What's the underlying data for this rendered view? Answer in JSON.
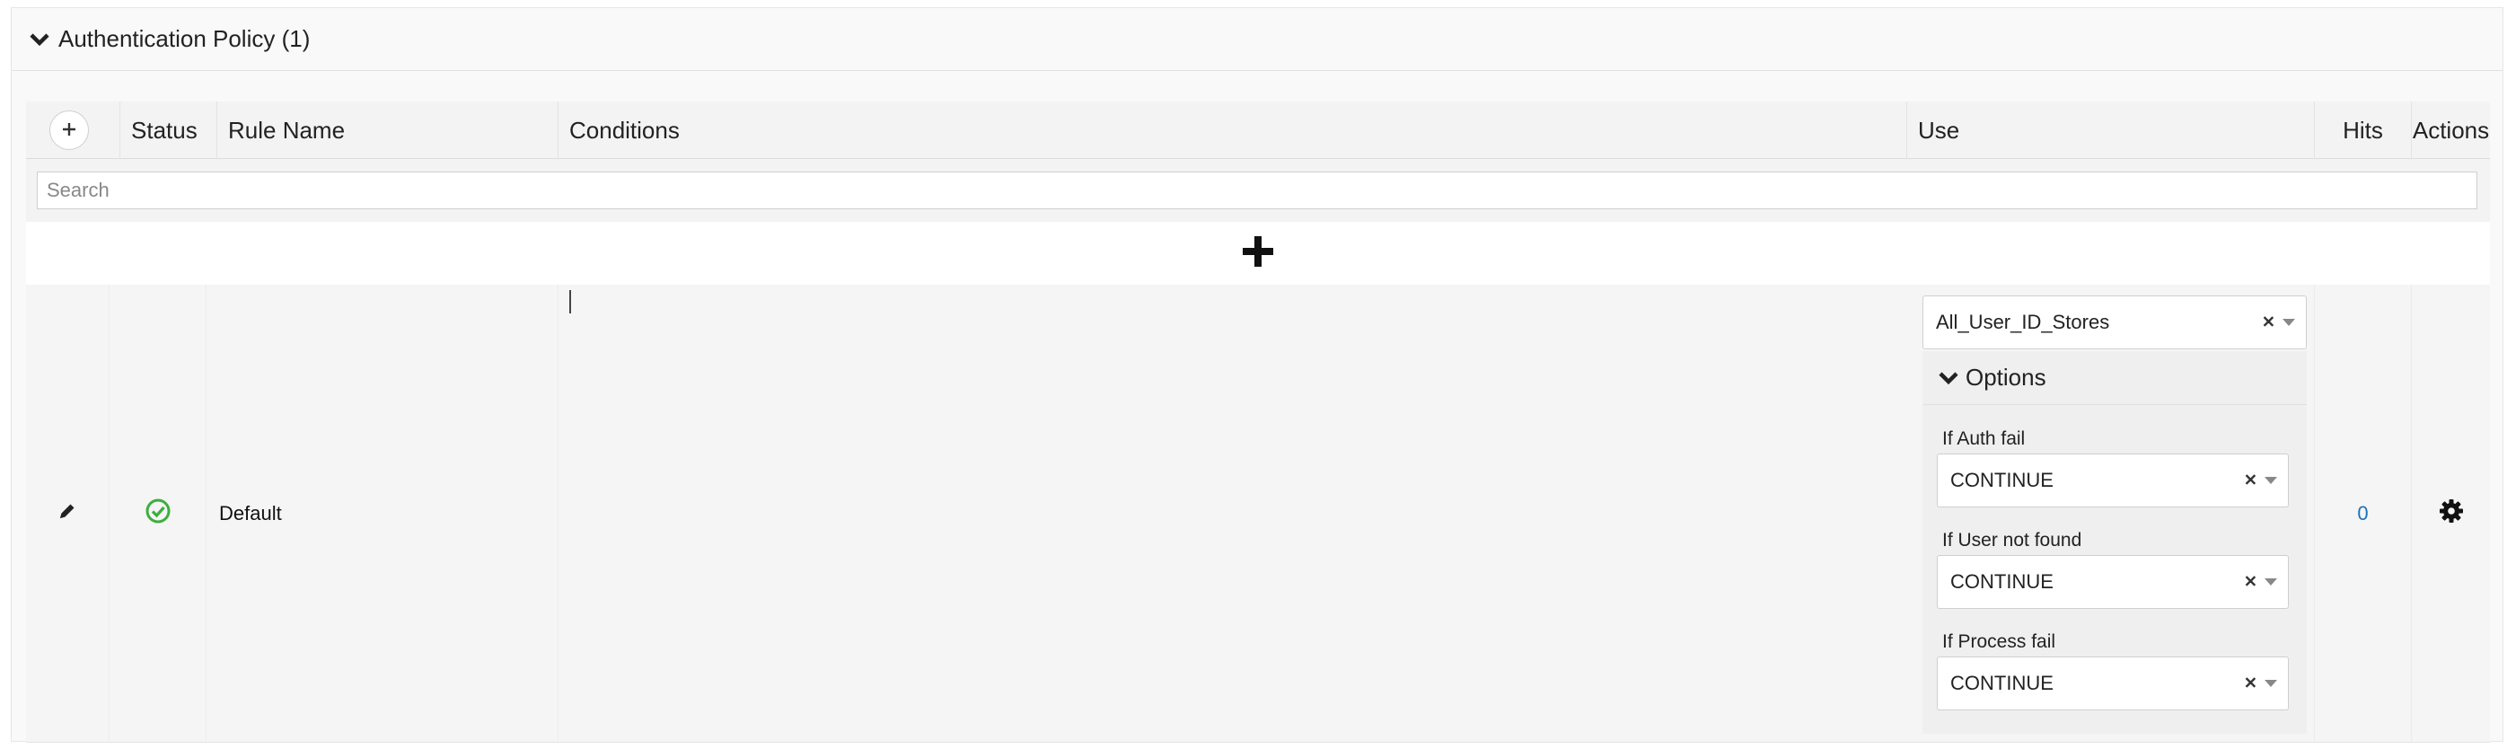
{
  "section": {
    "title": "Authentication Policy (1)"
  },
  "table": {
    "columns": {
      "status": "Status",
      "rule_name": "Rule Name",
      "conditions": "Conditions",
      "use": "Use",
      "hits": "Hits",
      "actions": "Actions"
    },
    "search_placeholder": "Search",
    "rows": [
      {
        "rule_name": "Default",
        "status": "enabled",
        "status_color": "#3cae3c",
        "hits": "0",
        "use": {
          "identity_source": "All_User_ID_Stores",
          "options_label": "Options",
          "if_auth_fail_label": "If Auth fail",
          "if_auth_fail_value": "CONTINUE",
          "if_user_not_found_label": "If User not found",
          "if_user_not_found_value": "CONTINUE",
          "if_process_fail_label": "If Process fail",
          "if_process_fail_value": "CONTINUE"
        }
      }
    ]
  },
  "colors": {
    "link": "#1a72bb",
    "status_ok": "#3cae3c"
  },
  "icons": {
    "section_toggle": "chevron-down-icon",
    "add_rule_header": "plus-circle-icon",
    "add_rule_row": "plus-icon",
    "edit": "pencil-icon",
    "status": "check-circle-icon",
    "actions": "gear-icon",
    "options_toggle": "chevron-down-icon"
  }
}
